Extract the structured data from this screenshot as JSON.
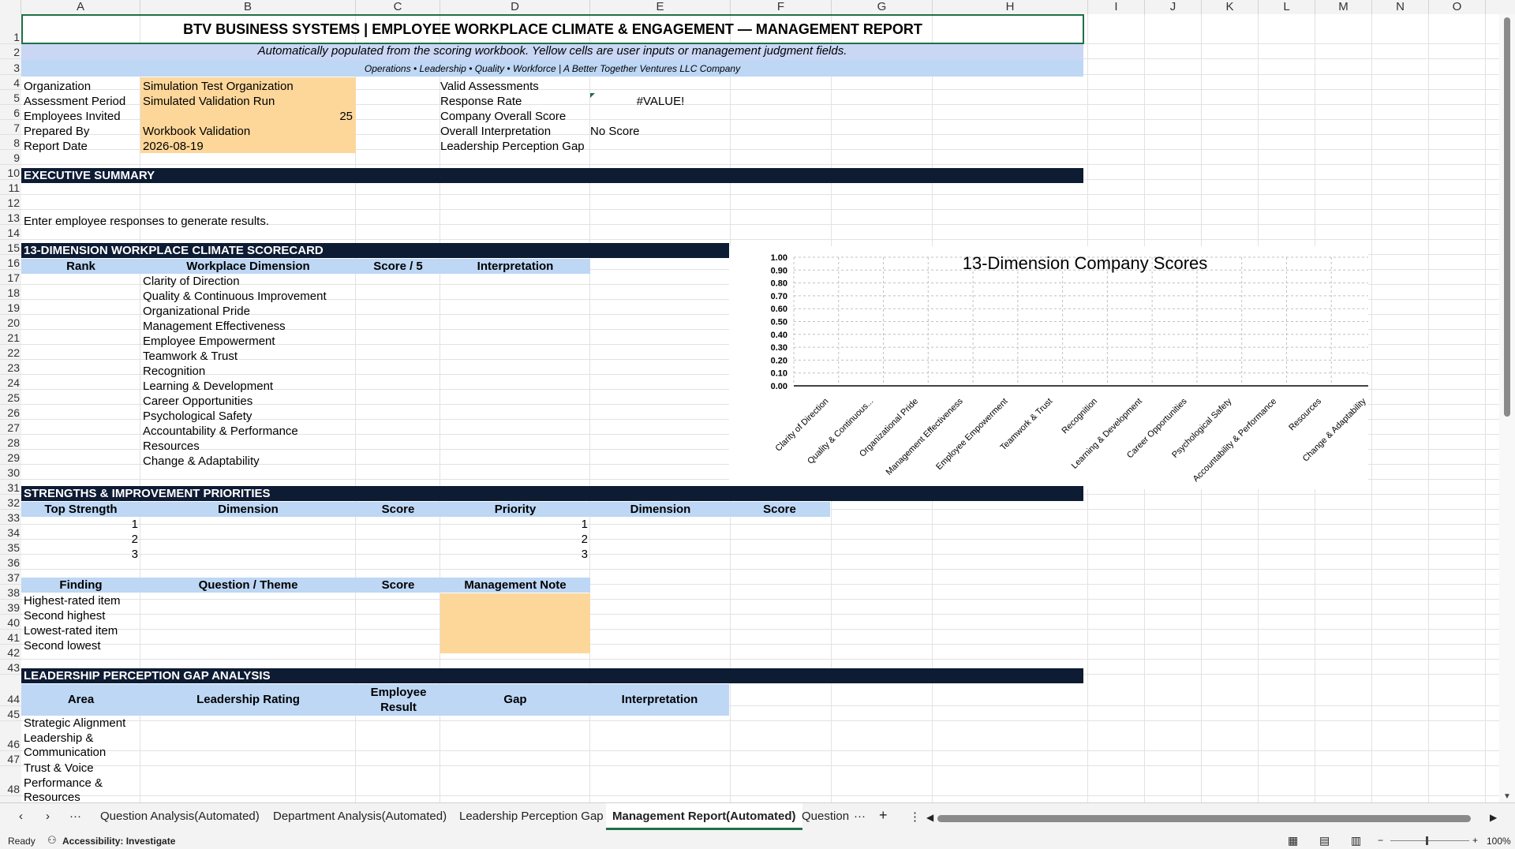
{
  "columns": [
    "A",
    "B",
    "C",
    "D",
    "E",
    "F",
    "G",
    "H",
    "I",
    "J",
    "K",
    "L",
    "M",
    "N",
    "O"
  ],
  "rows": [
    "1",
    "2",
    "3",
    "4",
    "5",
    "6",
    "7",
    "8",
    "9",
    "10",
    "11",
    "12",
    "13",
    "14",
    "15",
    "16",
    "17",
    "18",
    "19",
    "20",
    "21",
    "22",
    "23",
    "24",
    "25",
    "26",
    "27",
    "28",
    "29",
    "30",
    "31",
    "32",
    "33",
    "34",
    "35",
    "36",
    "37",
    "38",
    "39",
    "40",
    "41",
    "42",
    "43",
    "44",
    "45",
    "46",
    "47",
    "48"
  ],
  "report": {
    "title": "BTV BUSINESS SYSTEMS | EMPLOYEE WORKPLACE CLIMATE & ENGAGEMENT — MANAGEMENT REPORT",
    "note": "Automatically populated from the scoring workbook. Yellow cells are user inputs or management judgment fields.",
    "tagline": "Operations • Leadership • Quality • Workforce | A Better Together Ventures LLC Company"
  },
  "info": {
    "left": [
      {
        "label": "Organization",
        "value": "Simulation Test Organization"
      },
      {
        "label": "Assessment Period",
        "value": "Simulated Validation Run"
      },
      {
        "label": "Employees Invited",
        "value": "25"
      },
      {
        "label": "Prepared By",
        "value": "Workbook Validation"
      },
      {
        "label": "Report Date",
        "value": "2026-08-19"
      }
    ],
    "right": [
      {
        "label": "Valid Assessments",
        "value": ""
      },
      {
        "label": "Response Rate",
        "value": "#VALUE!"
      },
      {
        "label": "Company Overall Score",
        "value": ""
      },
      {
        "label": "Overall Interpretation",
        "value": "No Score"
      },
      {
        "label": "Leadership Perception Gap",
        "value": ""
      }
    ]
  },
  "executive": {
    "heading": "EXECUTIVE SUMMARY",
    "text": "Enter employee responses to generate results."
  },
  "scorecard": {
    "heading": "13-DIMENSION WORKPLACE CLIMATE SCORECARD",
    "headers": [
      "Rank",
      "Workplace Dimension",
      "Score / 5",
      "Interpretation"
    ],
    "dimensions": [
      "Clarity of Direction",
      "Quality & Continuous Improvement",
      "Organizational Pride",
      "Management Effectiveness",
      "Employee Empowerment",
      "Teamwork & Trust",
      "Recognition",
      "Learning & Development",
      "Career Opportunities",
      "Psychological Safety",
      "Accountability & Performance",
      "Resources",
      "Change & Adaptability"
    ]
  },
  "strengths": {
    "heading": "STRENGTHS & IMPROVEMENT PRIORITIES",
    "headers": [
      "Top Strength",
      "Dimension",
      "Score",
      "Priority",
      "Dimension",
      "Score"
    ],
    "ranks": [
      "1",
      "2",
      "3"
    ]
  },
  "findings": {
    "headers": [
      "Finding",
      "Question / Theme",
      "Score",
      "Management Note"
    ],
    "items": [
      "Highest-rated item",
      "Second highest",
      "Lowest-rated item",
      "Second lowest"
    ]
  },
  "gap": {
    "heading": "LEADERSHIP PERCEPTION GAP ANALYSIS",
    "headers": [
      "Area",
      "Leadership Rating",
      "Employee Result",
      "Gap",
      "Interpretation"
    ],
    "areas": [
      "Strategic Alignment",
      "Leadership & Communication",
      "Trust & Voice",
      "Performance & Resources"
    ]
  },
  "chart_data": {
    "type": "bar",
    "title": "13-Dimension Company Scores",
    "categories": [
      "Clarity of Direction",
      "Quality & Continuous...",
      "Organizational Pride",
      "Management Effectiveness",
      "Employee Empowerment",
      "Teamwork & Trust",
      "Recognition",
      "Learning & Development",
      "Career Opportunities",
      "Psychological Safety",
      "Accountability & Performance",
      "Resources",
      "Change & Adaptability"
    ],
    "values": [
      0,
      0,
      0,
      0,
      0,
      0,
      0,
      0,
      0,
      0,
      0,
      0,
      0
    ],
    "yticks": [
      "1.00",
      "0.90",
      "0.80",
      "0.70",
      "0.60",
      "0.50",
      "0.40",
      "0.30",
      "0.20",
      "0.10",
      "0.00"
    ],
    "ylim": [
      0,
      1
    ],
    "grid": true
  },
  "tabs": {
    "items": [
      "Question Analysis(Automated)",
      "Department Analysis(Automated)",
      "Leadership Perception Gap",
      "Management Report(Automated)",
      "Question"
    ],
    "active": "Management Report(Automated)",
    "more": "···",
    "add": "+"
  },
  "status": {
    "ready": "Ready",
    "accessibility": "Accessibility: Investigate",
    "zoom": "100%"
  },
  "colors": {
    "banner": "#0d1b33",
    "header_fill": "#bdd7f5",
    "input_fill": "#fdd79a",
    "note_fill": "#c9d7f5",
    "tagline_fill": "#bdd7f5",
    "selected": "#1e7145"
  }
}
